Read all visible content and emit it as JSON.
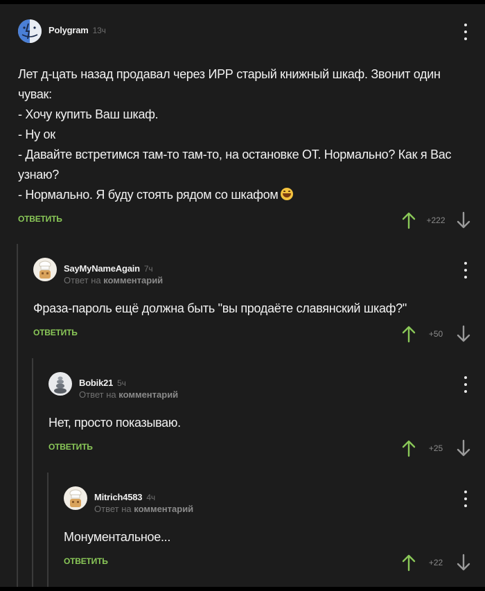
{
  "comments": [
    {
      "username": "Polygram",
      "time": "13ч",
      "reply_to": null,
      "lines": [
        "Лет д-цать назад продавал через ИРР старый книжный шкаф. Звонит один чувак:",
        "- Хочу купить Ваш шкаф.",
        "- Ну ок",
        "- Давайте встретимся там-то там-то, на остановке ОТ. Нормально? Как я Вас узнаю?",
        "- Нормально. Я буду стоять рядом со шкафом"
      ],
      "reply_label": "ОТВЕТИТЬ",
      "rating": "+222",
      "avatar_icon": "finder-face-icon"
    },
    {
      "username": "SayMyNameAgain",
      "time": "7ч",
      "reply_to": {
        "prefix": "Ответ на",
        "target": "комментарий"
      },
      "lines": [
        "Фраза-пароль ещё должна быть \"вы продаёте славянский шкаф?\""
      ],
      "reply_label": "ОТВЕТИТЬ",
      "rating": "+50",
      "avatar_icon": "chef-avatar-icon"
    },
    {
      "username": "Bobik21",
      "time": "5ч",
      "reply_to": {
        "prefix": "Ответ на",
        "target": "комментарий"
      },
      "lines": [
        "Нет, просто показываю."
      ],
      "reply_label": "ОТВЕТИТЬ",
      "rating": "+25",
      "avatar_icon": "stacked-stones-icon"
    },
    {
      "username": "Mitrich4583",
      "time": "4ч",
      "reply_to": {
        "prefix": "Ответ на",
        "target": "комментарий"
      },
      "lines": [
        "Монументальное..."
      ],
      "reply_label": "ОТВЕТИТЬ",
      "rating": "+22",
      "avatar_icon": "chef-avatar-icon"
    }
  ],
  "colors": {
    "background": "#1c1c1c",
    "accent_green": "#8ac858",
    "thread_line": "#3a3a3a",
    "muted_text": "#707070"
  }
}
